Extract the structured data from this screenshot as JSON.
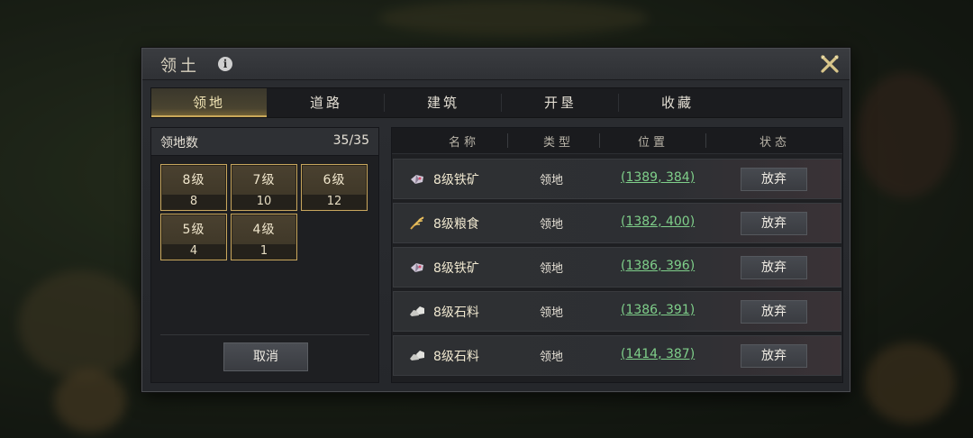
{
  "dialog": {
    "title": "领土",
    "tabs": [
      {
        "label": "领地",
        "active": true
      },
      {
        "label": "道路"
      },
      {
        "label": "建筑"
      },
      {
        "label": "开垦"
      },
      {
        "label": "收藏"
      }
    ]
  },
  "summary": {
    "label": "领地数",
    "count": "35/35",
    "levels": [
      {
        "name": "8级",
        "count": "8"
      },
      {
        "name": "7级",
        "count": "10"
      },
      {
        "name": "6级",
        "count": "12"
      },
      {
        "name": "5级",
        "count": "4"
      },
      {
        "name": "4级",
        "count": "1"
      }
    ],
    "cancel_label": "取消"
  },
  "table": {
    "columns": [
      "名称",
      "类型",
      "位置",
      "状态"
    ],
    "rows": [
      {
        "icon": "iron-ore-icon",
        "name": "8级铁矿",
        "type": "领地",
        "position": "(1389, 384)",
        "action": "放弃"
      },
      {
        "icon": "grain-icon",
        "name": "8级粮食",
        "type": "领地",
        "position": "(1382, 400)",
        "action": "放弃"
      },
      {
        "icon": "iron-ore-icon",
        "name": "8级铁矿",
        "type": "领地",
        "position": "(1386, 396)",
        "action": "放弃"
      },
      {
        "icon": "stone-icon",
        "name": "8级石料",
        "type": "领地",
        "position": "(1386, 391)",
        "action": "放弃"
      },
      {
        "icon": "stone-icon",
        "name": "8级石料",
        "type": "领地",
        "position": "(1414, 387)",
        "action": "放弃"
      }
    ]
  },
  "colors": {
    "accent_gold": "#c7a65e",
    "coordinate_green": "#7fcf8a"
  }
}
